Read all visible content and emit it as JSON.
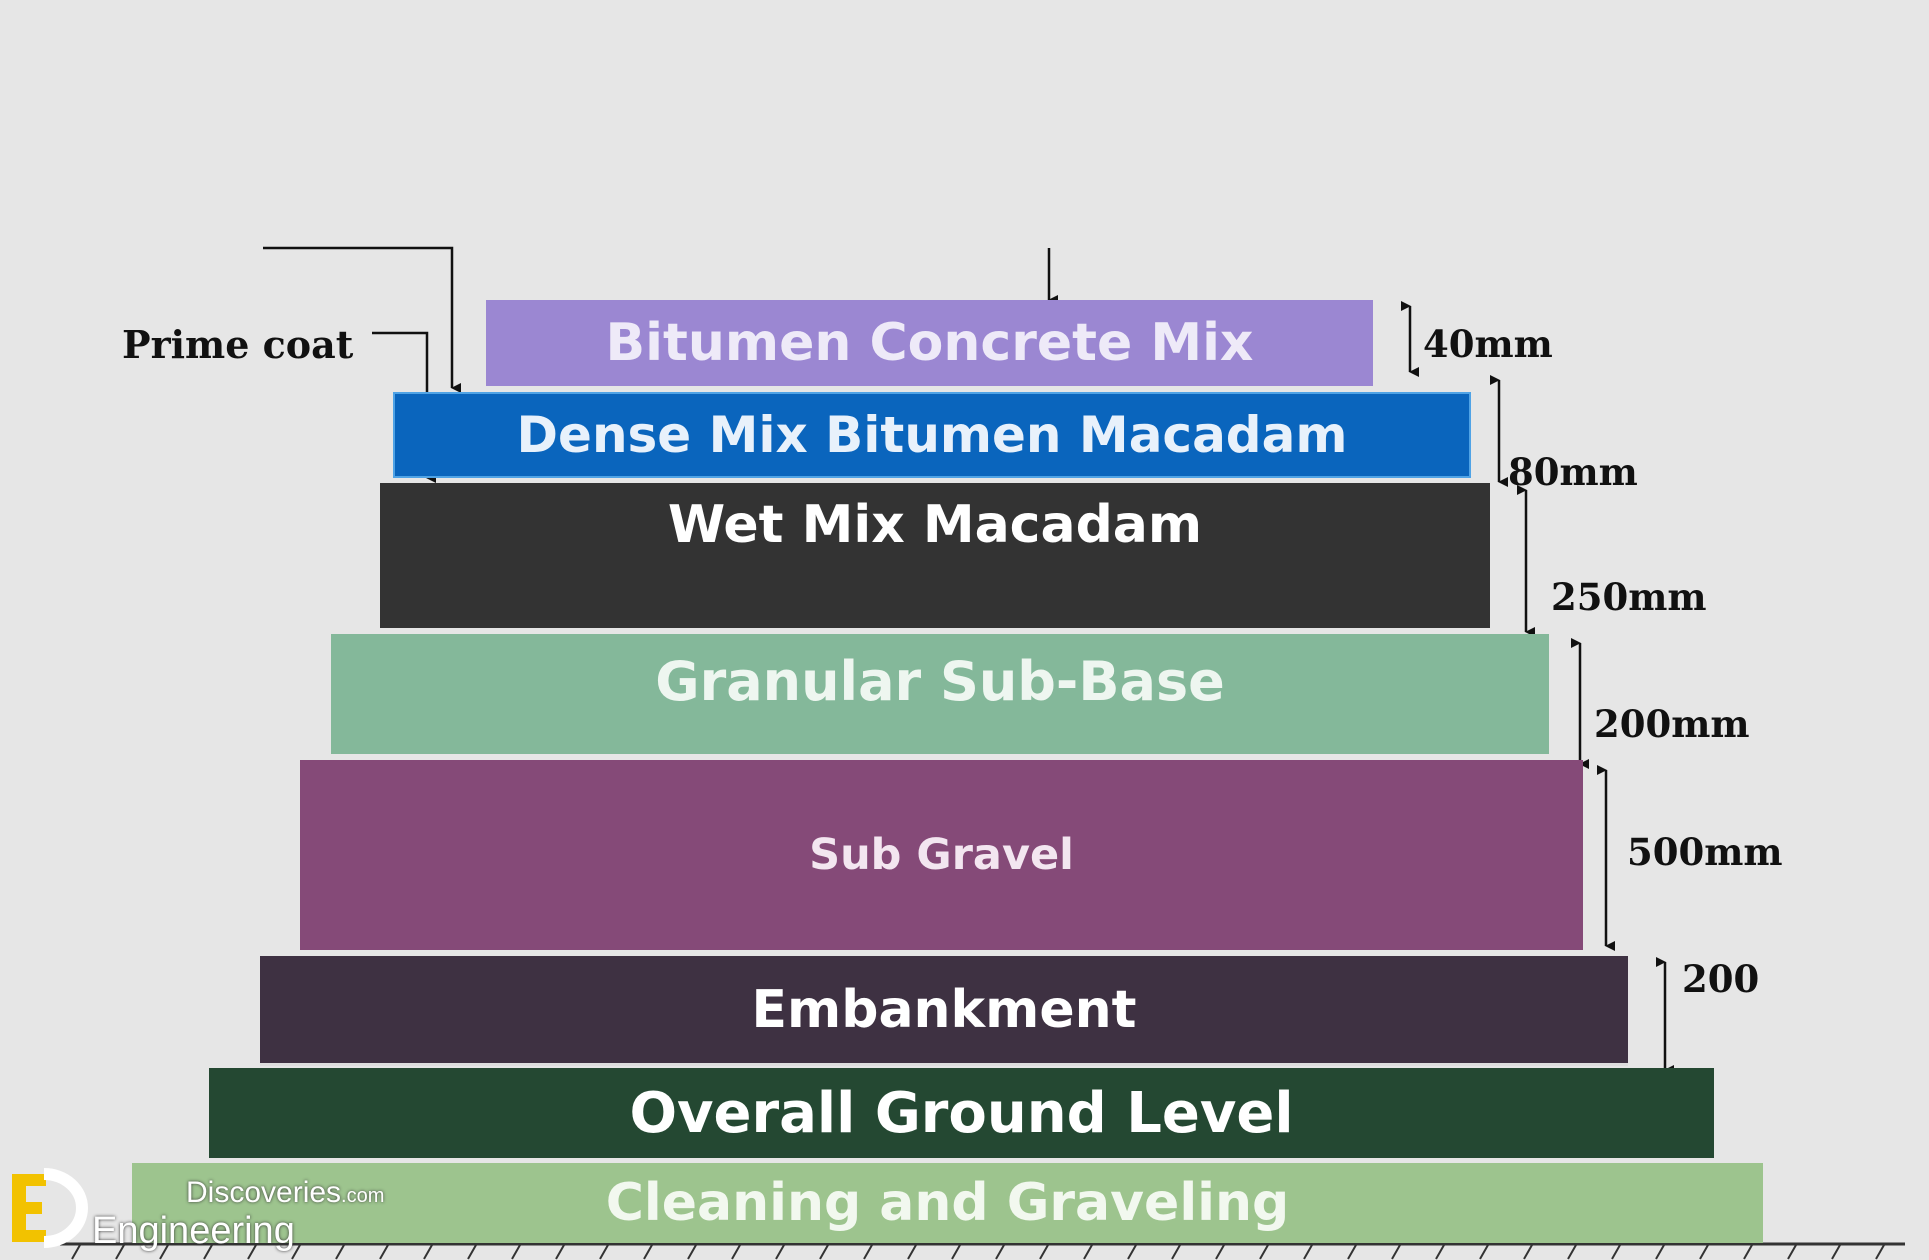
{
  "prime_coat_label": "Prime coat",
  "layers": [
    {
      "label": "Bitumen Concrete Mix",
      "color": "#9b87d2",
      "text_color": "#eeeaf8"
    },
    {
      "label": "Dense Mix  Bitumen Macadam",
      "color": "#0a65bd",
      "text_color": "#e8f1fb"
    },
    {
      "label": "Wet Mix Macadam",
      "color": "#333333",
      "text_color": "#ffffff"
    },
    {
      "label": "Granular Sub-Base",
      "color": "#84b89a",
      "text_color": "#eef6f0"
    },
    {
      "label": "Sub Gravel",
      "color": "#854a78",
      "text_color": "#f3e6f0"
    },
    {
      "label": "Embankment",
      "color": "#3e3142",
      "text_color": "#ffffff"
    },
    {
      "label": "Overall Ground Level",
      "color": "#244832",
      "text_color": "#ffffff"
    },
    {
      "label": "Cleaning and Graveling",
      "color": "#9dc48e",
      "text_color": "#f2f8ef"
    }
  ],
  "dimensions": [
    "40mm",
    "80mm",
    "250mm",
    "200mm",
    "500mm",
    "200"
  ],
  "logo": {
    "line1": "Discoveries",
    "line1_suffix": ".com",
    "line2": "Engineering"
  }
}
